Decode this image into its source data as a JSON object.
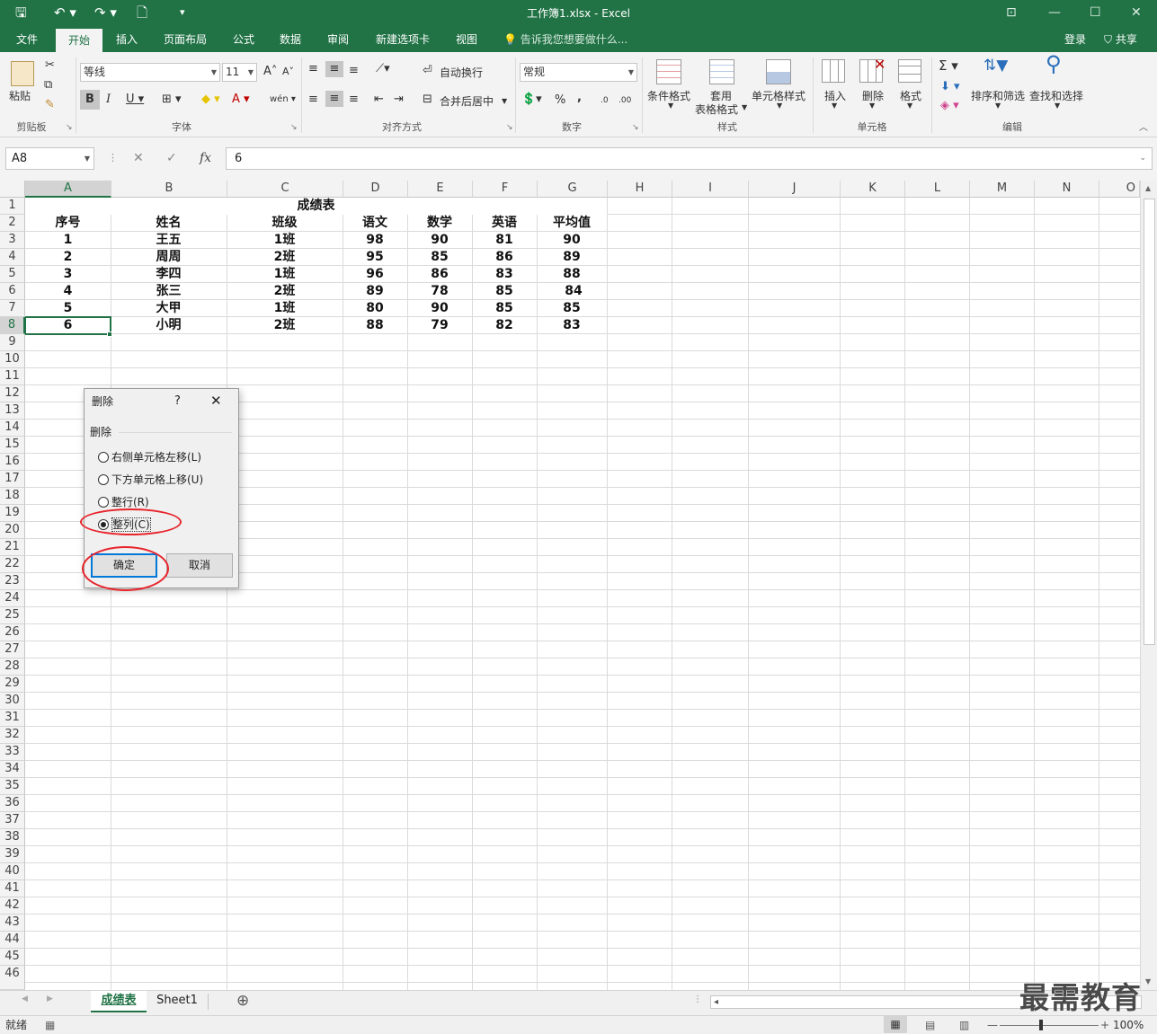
{
  "window": {
    "title": "工作簿1.xlsx - Excel",
    "qa_icons": [
      "save-icon",
      "undo-icon",
      "redo-icon",
      "new-doc-icon",
      "customize-icon"
    ],
    "qa_glyphs": {
      "save": "🖫",
      "undo": "↶ ▾",
      "redo": "↷ ▾",
      "new": "🗋",
      "customize": "▾"
    },
    "controls": {
      "ribbon_opts": "⊡",
      "minimize": "—",
      "maximize": "☐",
      "close": "✕"
    }
  },
  "tabs": [
    {
      "label": "文件",
      "active": false
    },
    {
      "label": "开始",
      "active": true
    },
    {
      "label": "插入",
      "active": false
    },
    {
      "label": "页面布局",
      "active": false
    },
    {
      "label": "公式",
      "active": false
    },
    {
      "label": "数据",
      "active": false
    },
    {
      "label": "审阅",
      "active": false
    },
    {
      "label": "新建选项卡",
      "active": false
    },
    {
      "label": "视图",
      "active": false
    }
  ],
  "tell_me": "💡 告诉我您想要做什么...",
  "account": {
    "login": "登录",
    "share": "⛉ 共享"
  },
  "ribbon": {
    "clipboard": {
      "label": "剪贴板",
      "paste": "粘贴"
    },
    "font": {
      "label": "字体",
      "font_name": "等线",
      "font_size": "11",
      "grow": "A˄",
      "shrink": "A˅",
      "bold": "B",
      "italic": "I",
      "underline": "U ▾",
      "border": "⊞ ▾",
      "fill": "◆ ▾",
      "font_color": "A ▾",
      "phonetic": "wén ▾"
    },
    "align": {
      "label": "对齐方式",
      "wrap": "自动换行",
      "merge": "合并后居中"
    },
    "number": {
      "label": "数字",
      "format": "常规",
      "percent": "%",
      "comma": ",",
      "accounting": "💲▾",
      "inc_dec": ".0",
      "dec_dec": ".00"
    },
    "styles": {
      "label": "样式",
      "conditional": "条件格式",
      "table_l1": "套用",
      "table_l2": "表格格式",
      "cell_styles": "单元格样式"
    },
    "cells": {
      "label": "单元格",
      "insert": "插入",
      "delete": "删除",
      "format": "格式"
    },
    "editing": {
      "label": "编辑",
      "sum": "Σ ▾",
      "fill": "⬇ ▾",
      "clear": "◈ ▾",
      "sort": "排序和筛选",
      "find": "查找和选择"
    }
  },
  "formula_bar": {
    "name_box": "A8",
    "cancel": "✕",
    "enter": "✓",
    "fx": "fx",
    "value": "6"
  },
  "columns": [
    "A",
    "B",
    "C",
    "D",
    "E",
    "F",
    "G",
    "H",
    "I",
    "J",
    "K",
    "L",
    "M",
    "N",
    "O"
  ],
  "selected_col": "A",
  "selected_row": 8,
  "rows": [
    "1",
    "2",
    "3",
    "4",
    "5",
    "6",
    "7",
    "8",
    "9",
    "10",
    "11",
    "12",
    "13",
    "14",
    "15",
    "16",
    "17",
    "18",
    "19",
    "20",
    "21",
    "22",
    "23",
    "24",
    "25",
    "26",
    "27",
    "28",
    "29",
    "30",
    "31",
    "32",
    "33",
    "34",
    "35",
    "36",
    "37",
    "38",
    "39",
    "40",
    "41",
    "42",
    "43",
    "44",
    "45",
    "46"
  ],
  "sheet": {
    "title": "成绩表",
    "headers": [
      "序号",
      "姓名",
      "班级",
      "语文",
      "数学",
      "英语",
      "平均值"
    ],
    "rows": [
      [
        "1",
        "王五",
        "1班",
        "98",
        "90",
        "81",
        "90"
      ],
      [
        "2",
        "周周",
        "2班",
        "95",
        "85",
        "86",
        "89"
      ],
      [
        "3",
        "李四",
        "1班",
        "96",
        "86",
        "83",
        "88"
      ],
      [
        "4",
        "张三",
        "2班",
        "89",
        "78",
        "85",
        "84"
      ],
      [
        "5",
        "大甲",
        "1班",
        "80",
        "90",
        "85",
        "85"
      ],
      [
        "6",
        "小明",
        "2班",
        "88",
        "79",
        "82",
        "83"
      ]
    ]
  },
  "sheet_tabs": [
    {
      "label": "成绩表",
      "active": true
    },
    {
      "label": "Sheet1",
      "active": false
    }
  ],
  "sheet_nav": {
    "prev": "◀",
    "next": "▶",
    "add": "⊕",
    "hscroll_left": "◂"
  },
  "status": {
    "ready": "就绪",
    "macro_icon": "▦",
    "view_normal": "▦",
    "view_layout": "▤",
    "view_break": "▥",
    "zoom_out": "—",
    "zoom_in": "+",
    "zoom": "100%"
  },
  "dialog": {
    "title": "删除",
    "help": "?",
    "close": "✕",
    "group": "删除",
    "options": [
      {
        "label": "右侧单元格左移(L)",
        "selected": false
      },
      {
        "label": "下方单元格上移(U)",
        "selected": false
      },
      {
        "label": "整行(R)",
        "selected": false
      },
      {
        "label": "整列(C)",
        "selected": true
      }
    ],
    "ok": "确定",
    "cancel": "取消"
  },
  "watermark": "最需教育",
  "colors": {
    "accent": "#217346",
    "annotation": "#e8242b",
    "default_button": "#0078d7"
  }
}
